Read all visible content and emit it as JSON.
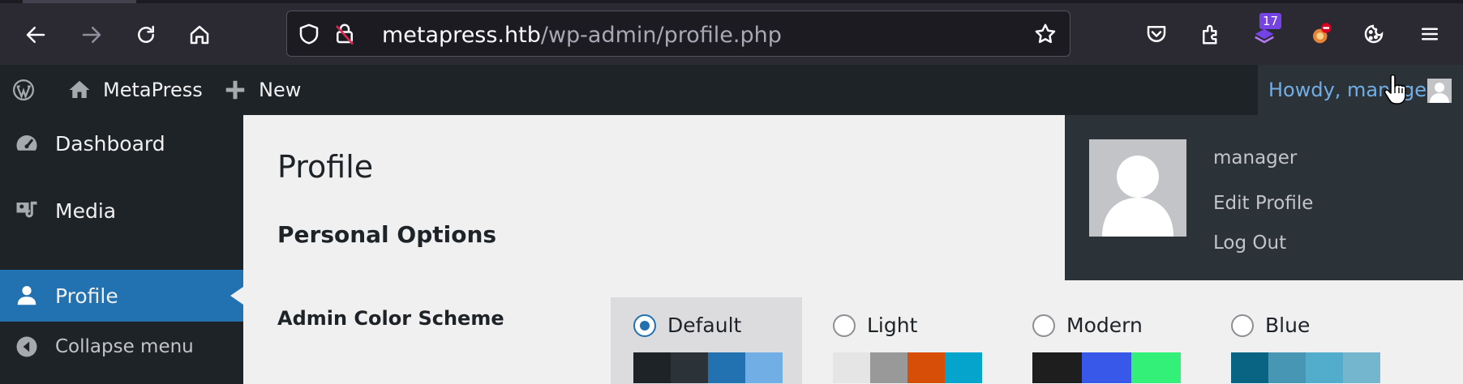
{
  "browser": {
    "url_host": "metapress.htb",
    "url_path": "/wp-admin/profile.php",
    "extension_badge": "17",
    "icons": [
      "back-arrow-icon",
      "forward-arrow-icon",
      "reload-icon",
      "home-icon",
      "shield-icon",
      "insecure-lock-icon",
      "star-icon",
      "pocket-icon",
      "extensions-icon",
      "container-icon",
      "foxyproxy-icon",
      "cookie-icon",
      "menu-icon"
    ]
  },
  "adminbar": {
    "site_name": "MetaPress",
    "new_label": "New",
    "howdy": "Howdy, manager"
  },
  "sidebar": {
    "items": [
      {
        "label": "Dashboard",
        "icon": "dashboard-icon"
      },
      {
        "label": "Media",
        "icon": "media-icon"
      },
      {
        "label": "Profile",
        "icon": "user-icon",
        "current": true
      },
      {
        "label": "Collapse menu",
        "icon": "collapse-icon"
      }
    ]
  },
  "main": {
    "title": "Profile",
    "section": "Personal Options",
    "color_scheme_label": "Admin Color Scheme",
    "schemes": [
      {
        "label": "Default",
        "checked": true,
        "colors": [
          "#1d2327",
          "#2c3338",
          "#2271b1",
          "#72aee6"
        ]
      },
      {
        "label": "Light",
        "checked": false,
        "colors": [
          "#e5e5e5",
          "#999999",
          "#d64e07",
          "#04a4cc"
        ]
      },
      {
        "label": "Modern",
        "checked": false,
        "colors": [
          "#1e1e1e",
          "#3858e9",
          "#33f078"
        ]
      },
      {
        "label": "Blue",
        "checked": false,
        "colors": [
          "#096484",
          "#4796b3",
          "#52accc",
          "#74b6ce"
        ]
      }
    ]
  },
  "dropdown": {
    "username": "manager",
    "edit_profile": "Edit Profile",
    "log_out": "Log Out"
  },
  "colors": {
    "wp_dark": "#1d2327",
    "wp_blue": "#2271b1",
    "link_blue": "#72aee6",
    "browser_bg": "#2b2a33"
  }
}
